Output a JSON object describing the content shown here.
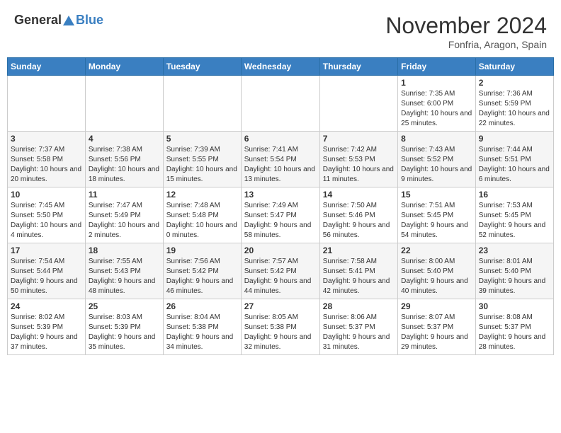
{
  "header": {
    "logo": {
      "general": "General",
      "blue": "Blue"
    },
    "title": "November 2024",
    "location": "Fonfria, Aragon, Spain"
  },
  "calendar": {
    "weekdays": [
      "Sunday",
      "Monday",
      "Tuesday",
      "Wednesday",
      "Thursday",
      "Friday",
      "Saturday"
    ],
    "weeks": [
      [
        {
          "day": "",
          "info": ""
        },
        {
          "day": "",
          "info": ""
        },
        {
          "day": "",
          "info": ""
        },
        {
          "day": "",
          "info": ""
        },
        {
          "day": "",
          "info": ""
        },
        {
          "day": "1",
          "info": "Sunrise: 7:35 AM\nSunset: 6:00 PM\nDaylight: 10 hours and 25 minutes."
        },
        {
          "day": "2",
          "info": "Sunrise: 7:36 AM\nSunset: 5:59 PM\nDaylight: 10 hours and 22 minutes."
        }
      ],
      [
        {
          "day": "3",
          "info": "Sunrise: 7:37 AM\nSunset: 5:58 PM\nDaylight: 10 hours and 20 minutes."
        },
        {
          "day": "4",
          "info": "Sunrise: 7:38 AM\nSunset: 5:56 PM\nDaylight: 10 hours and 18 minutes."
        },
        {
          "day": "5",
          "info": "Sunrise: 7:39 AM\nSunset: 5:55 PM\nDaylight: 10 hours and 15 minutes."
        },
        {
          "day": "6",
          "info": "Sunrise: 7:41 AM\nSunset: 5:54 PM\nDaylight: 10 hours and 13 minutes."
        },
        {
          "day": "7",
          "info": "Sunrise: 7:42 AM\nSunset: 5:53 PM\nDaylight: 10 hours and 11 minutes."
        },
        {
          "day": "8",
          "info": "Sunrise: 7:43 AM\nSunset: 5:52 PM\nDaylight: 10 hours and 9 minutes."
        },
        {
          "day": "9",
          "info": "Sunrise: 7:44 AM\nSunset: 5:51 PM\nDaylight: 10 hours and 6 minutes."
        }
      ],
      [
        {
          "day": "10",
          "info": "Sunrise: 7:45 AM\nSunset: 5:50 PM\nDaylight: 10 hours and 4 minutes."
        },
        {
          "day": "11",
          "info": "Sunrise: 7:47 AM\nSunset: 5:49 PM\nDaylight: 10 hours and 2 minutes."
        },
        {
          "day": "12",
          "info": "Sunrise: 7:48 AM\nSunset: 5:48 PM\nDaylight: 10 hours and 0 minutes."
        },
        {
          "day": "13",
          "info": "Sunrise: 7:49 AM\nSunset: 5:47 PM\nDaylight: 9 hours and 58 minutes."
        },
        {
          "day": "14",
          "info": "Sunrise: 7:50 AM\nSunset: 5:46 PM\nDaylight: 9 hours and 56 minutes."
        },
        {
          "day": "15",
          "info": "Sunrise: 7:51 AM\nSunset: 5:45 PM\nDaylight: 9 hours and 54 minutes."
        },
        {
          "day": "16",
          "info": "Sunrise: 7:53 AM\nSunset: 5:45 PM\nDaylight: 9 hours and 52 minutes."
        }
      ],
      [
        {
          "day": "17",
          "info": "Sunrise: 7:54 AM\nSunset: 5:44 PM\nDaylight: 9 hours and 50 minutes."
        },
        {
          "day": "18",
          "info": "Sunrise: 7:55 AM\nSunset: 5:43 PM\nDaylight: 9 hours and 48 minutes."
        },
        {
          "day": "19",
          "info": "Sunrise: 7:56 AM\nSunset: 5:42 PM\nDaylight: 9 hours and 46 minutes."
        },
        {
          "day": "20",
          "info": "Sunrise: 7:57 AM\nSunset: 5:42 PM\nDaylight: 9 hours and 44 minutes."
        },
        {
          "day": "21",
          "info": "Sunrise: 7:58 AM\nSunset: 5:41 PM\nDaylight: 9 hours and 42 minutes."
        },
        {
          "day": "22",
          "info": "Sunrise: 8:00 AM\nSunset: 5:40 PM\nDaylight: 9 hours and 40 minutes."
        },
        {
          "day": "23",
          "info": "Sunrise: 8:01 AM\nSunset: 5:40 PM\nDaylight: 9 hours and 39 minutes."
        }
      ],
      [
        {
          "day": "24",
          "info": "Sunrise: 8:02 AM\nSunset: 5:39 PM\nDaylight: 9 hours and 37 minutes."
        },
        {
          "day": "25",
          "info": "Sunrise: 8:03 AM\nSunset: 5:39 PM\nDaylight: 9 hours and 35 minutes."
        },
        {
          "day": "26",
          "info": "Sunrise: 8:04 AM\nSunset: 5:38 PM\nDaylight: 9 hours and 34 minutes."
        },
        {
          "day": "27",
          "info": "Sunrise: 8:05 AM\nSunset: 5:38 PM\nDaylight: 9 hours and 32 minutes."
        },
        {
          "day": "28",
          "info": "Sunrise: 8:06 AM\nSunset: 5:37 PM\nDaylight: 9 hours and 31 minutes."
        },
        {
          "day": "29",
          "info": "Sunrise: 8:07 AM\nSunset: 5:37 PM\nDaylight: 9 hours and 29 minutes."
        },
        {
          "day": "30",
          "info": "Sunrise: 8:08 AM\nSunset: 5:37 PM\nDaylight: 9 hours and 28 minutes."
        }
      ]
    ]
  }
}
